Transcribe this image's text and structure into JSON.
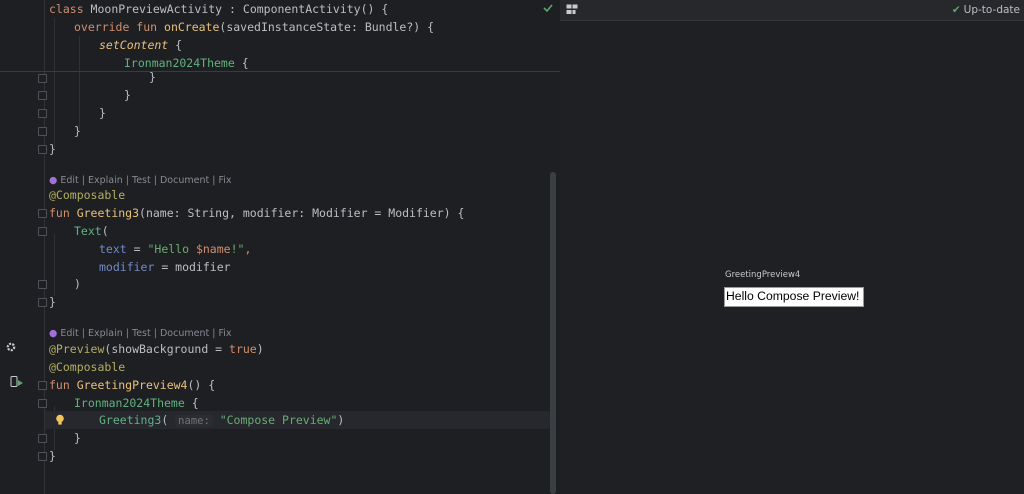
{
  "editor": {
    "lines": {
      "l1": {
        "a": "class ",
        "b": "MoonPreviewActivity",
        "c": " : ",
        "d": "ComponentActivity",
        "e": "() {"
      },
      "l2": {
        "a": "override fun ",
        "b": "onCreate",
        "c": "(savedInstanceState: ",
        "d": "Bundle",
        "e": "?) {"
      },
      "l3": {
        "a": "setContent",
        "b": " {"
      },
      "l4": {
        "a": "Ironman2024Theme",
        "b": " {"
      },
      "l5": "}",
      "l6": "}",
      "l7": "}",
      "l8": "}",
      "l9": "}",
      "l10": {
        "a": "@Composable"
      },
      "l11": {
        "a": "fun ",
        "b": "Greeting3",
        "c": "(name: String, modifier: Modifier = Modifier) {"
      },
      "l12": {
        "a": "Text",
        "b": "("
      },
      "l13": {
        "a": "text",
        "b": " = ",
        "c": "\"Hello ",
        "d": "$name",
        "e": "!\"",
        "f": ","
      },
      "l14": {
        "a": "modifier",
        "b": " = modifier"
      },
      "l15": ")",
      "l16": "}",
      "l17": {
        "a": "@Preview",
        "b": "(showBackground = ",
        "c": "true",
        "d": ")"
      },
      "l18": {
        "a": "@Composable"
      },
      "l19": {
        "a": "fun ",
        "b": "GreetingPreview4",
        "c": "() {"
      },
      "l20": {
        "a": "Ironman2024Theme",
        "b": " {"
      },
      "l21": {
        "a": "Greeting3",
        "b": "( ",
        "hint": "name:",
        "c": " \"Compose Preview\"",
        "d": ")"
      },
      "l22": "}",
      "l23": "}"
    },
    "code_lens": {
      "edit": "Edit",
      "explain": "Explain",
      "test": "Test",
      "document": "Document",
      "fix": "Fix",
      "divider": " | "
    }
  },
  "preview": {
    "status": "Up-to-date",
    "component_name": "GreetingPreview4",
    "rendered_text": "Hello Compose Preview!"
  },
  "icons": {
    "check": "check-icon",
    "gear": "gear-icon",
    "run": "run-preview-icon",
    "bulb": "lightbulb-icon",
    "layout": "layout-icon"
  },
  "colors": {
    "editor_bg": "#1e1f22",
    "keyword": "#cf8e6d",
    "function": "#56a8f5",
    "annotation": "#b3ae60",
    "string": "#6aab73",
    "status_ok": "#59a869"
  }
}
